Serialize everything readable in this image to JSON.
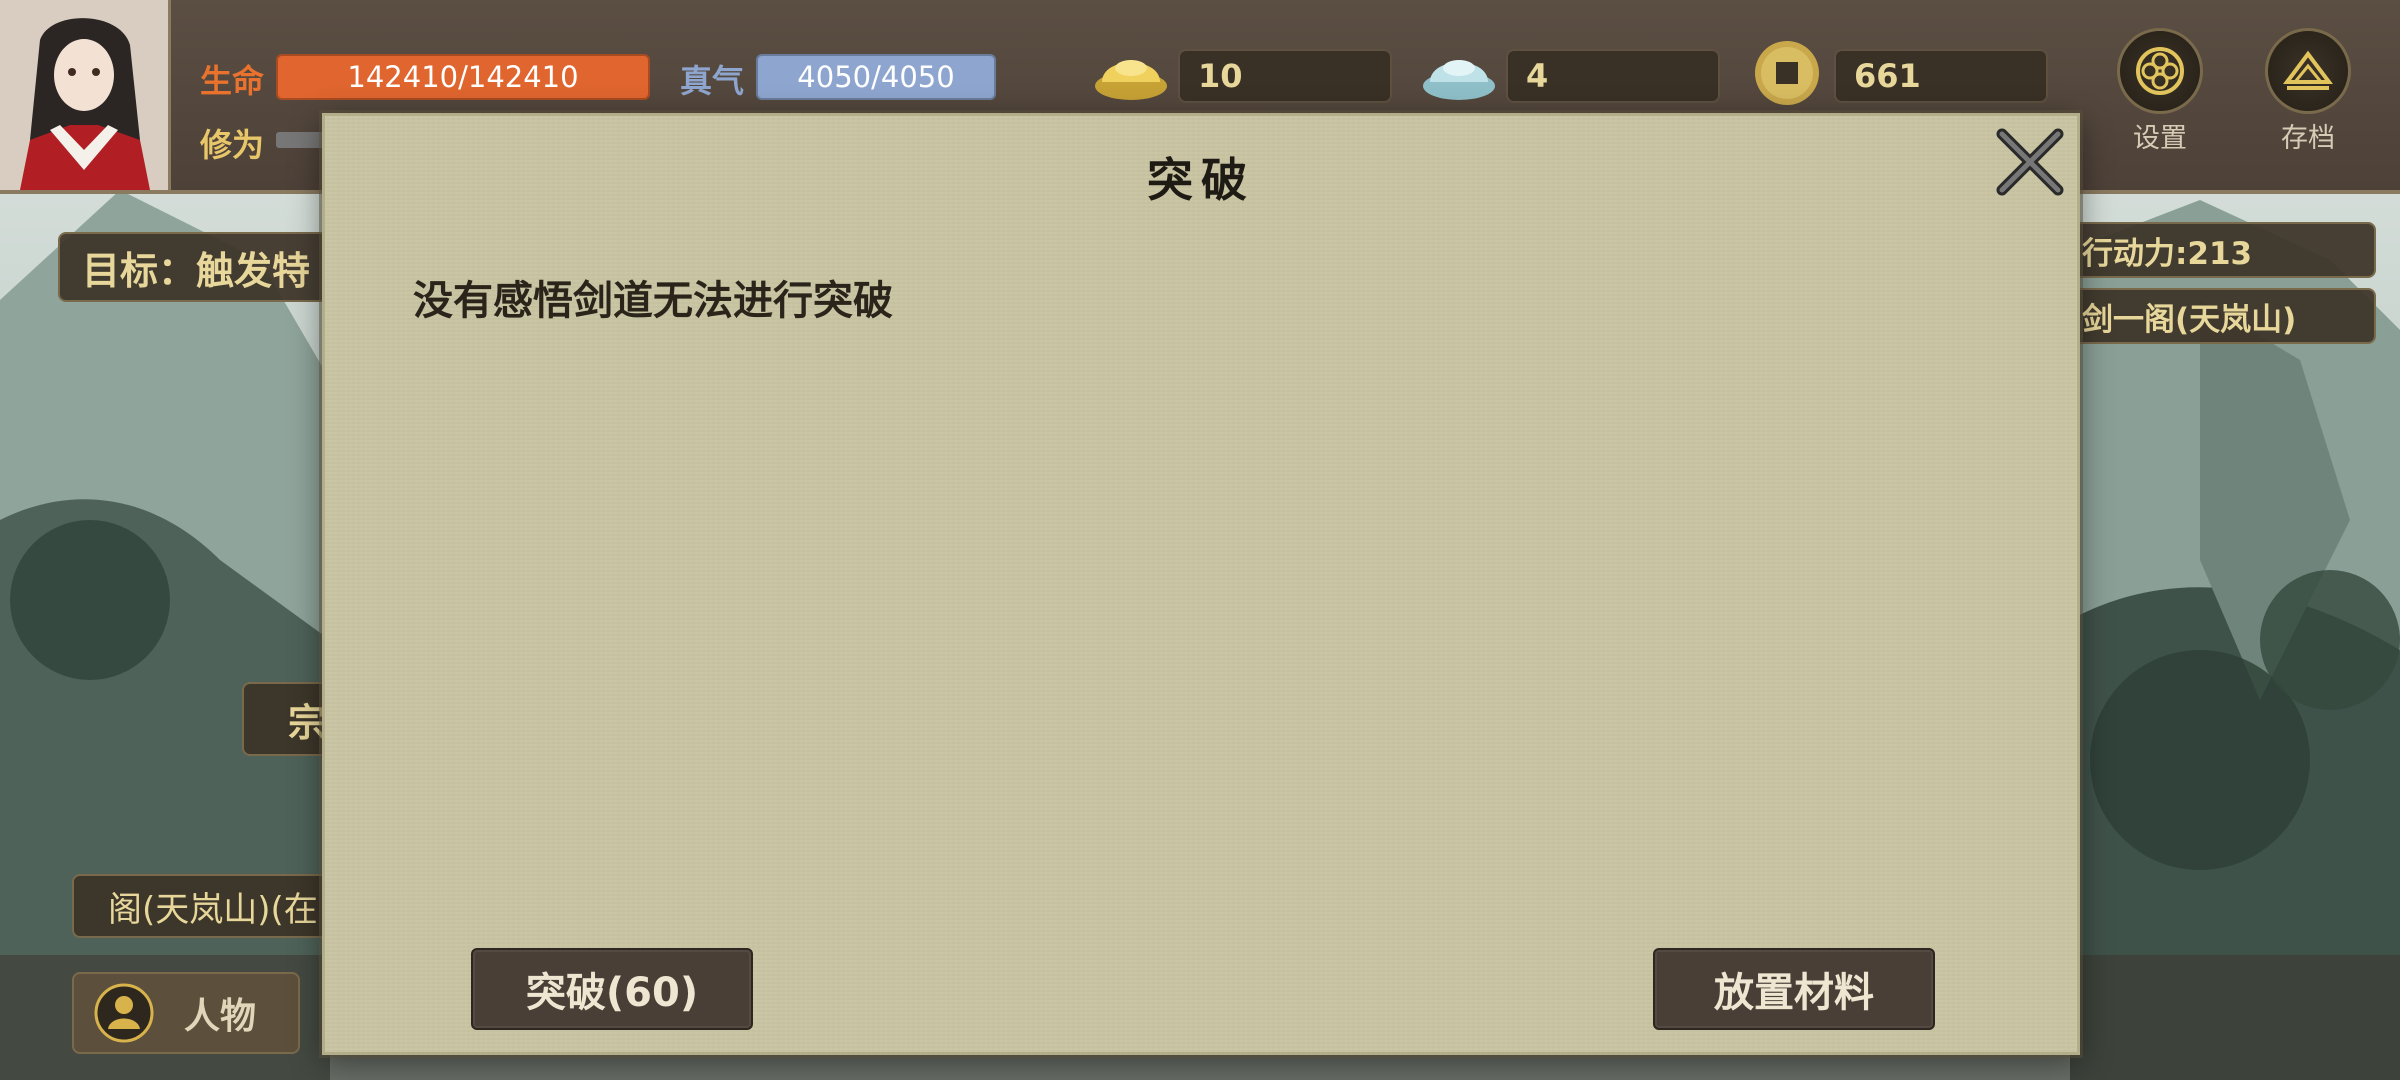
{
  "stats": {
    "hp_label": "生命",
    "hp_value": "142410/142410",
    "qi_label": "真气",
    "qi_value": "4050/4050",
    "cultivation_label": "修为"
  },
  "currency": {
    "gold": "10",
    "jade": "4",
    "coins": "661"
  },
  "menu": {
    "settings_label": "设置",
    "save_label": "存档"
  },
  "hud": {
    "goal_text": "目标：触发特",
    "action_points": "行动力:213",
    "location_right": "剑一阁(天岚山)",
    "location_left": "阁(天岚山)(在",
    "sect_partial": "宗",
    "character_label": "人物"
  },
  "dialog": {
    "title": "突破",
    "message": "没有感悟剑道无法进行突破",
    "breakthrough_button": "突破(60)",
    "place_material_button": "放置材料"
  },
  "colors": {
    "hp_bar": "#e0652e",
    "qi_bar": "#8ea6cf",
    "hp_label": "#e8722e",
    "qi_label": "#8ea6cf",
    "dialog_bg": "#c9c4a2",
    "button_bg": "#4a3f37"
  }
}
